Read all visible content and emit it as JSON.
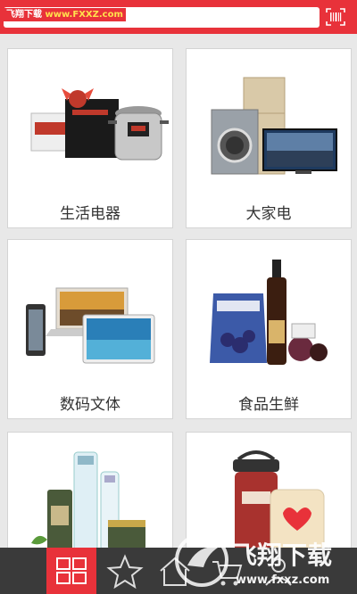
{
  "header": {
    "watermark_site": "飞翔下载",
    "watermark_url": "www.FXXZ.com",
    "scan_icon": "barcode-scan-icon",
    "accent_color": "#e8323a"
  },
  "categories": [
    {
      "label": "生活电器",
      "illustration": "appliances-image"
    },
    {
      "label": "大家电",
      "illustration": "large-appliances-image"
    },
    {
      "label": "数码文体",
      "illustration": "digital-devices-image"
    },
    {
      "label": "食品生鲜",
      "illustration": "fresh-food-image"
    },
    {
      "label": "",
      "illustration": "cosmetics-image"
    },
    {
      "label": "",
      "illustration": "home-goods-image"
    }
  ],
  "bottom_nav": {
    "items": [
      {
        "icon": "grid-icon",
        "active": true
      },
      {
        "icon": "star-icon",
        "active": false
      },
      {
        "icon": "home-icon",
        "active": false
      },
      {
        "icon": "cart-icon",
        "active": false
      },
      {
        "icon": "user-icon",
        "active": false
      }
    ]
  },
  "watermark_logo": {
    "title": "飞翔下载",
    "url": "www.fxxz.com"
  }
}
